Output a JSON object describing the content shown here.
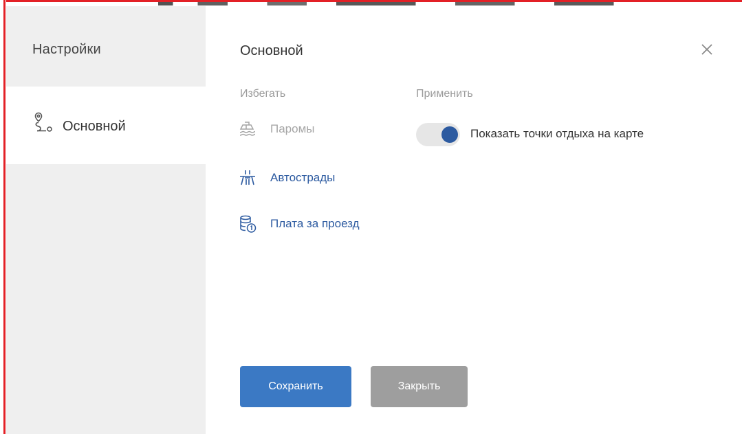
{
  "sidebar": {
    "title": "Настройки",
    "items": [
      {
        "label": "Основной",
        "icon": "route-icon",
        "selected": true
      }
    ]
  },
  "main": {
    "title": "Основной",
    "close_icon": "close-icon",
    "avoid": {
      "heading": "Избегать",
      "items": [
        {
          "label": "Паромы",
          "icon": "ferry-icon",
          "state": "disabled"
        },
        {
          "label": "Автострады",
          "icon": "highway-icon",
          "state": "active"
        },
        {
          "label": "Плата за проезд",
          "icon": "toll-coins-icon",
          "state": "active"
        }
      ]
    },
    "apply": {
      "heading": "Применить",
      "toggle": {
        "label": "Показать точки отдыха на карте",
        "on": true
      }
    },
    "buttons": {
      "save_label": "Сохранить",
      "close_label": "Закрыть"
    }
  },
  "colors": {
    "accent": "#2c5aa0",
    "save_button": "#3b79c4",
    "close_button": "#9e9e9e",
    "sidebar_bg": "#efefef",
    "frame_red": "#e32026"
  }
}
